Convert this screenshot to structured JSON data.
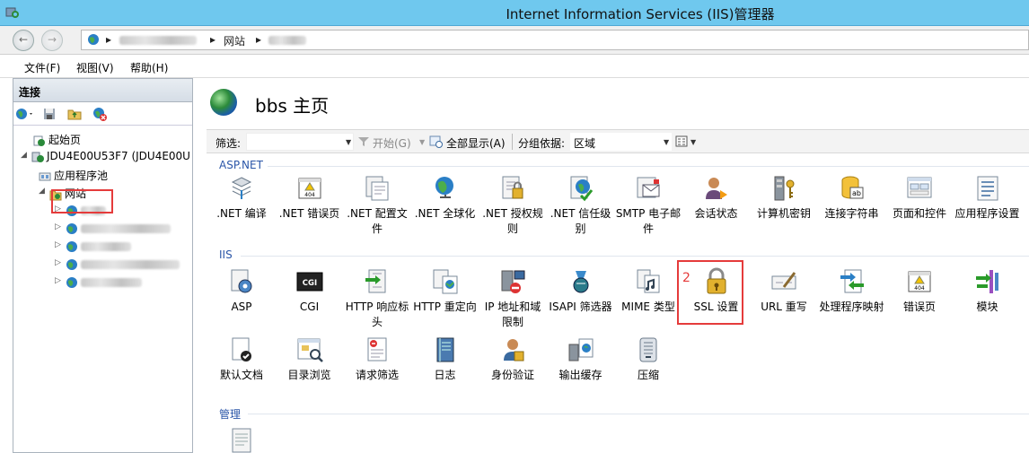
{
  "window": {
    "title": "Internet Information Services (IIS)管理器"
  },
  "address": {
    "crumbs": [
      "网站"
    ]
  },
  "menu": [
    "文件(F)",
    "视图(V)",
    "帮助(H)"
  ],
  "connections": {
    "header": "连接",
    "tree": [
      {
        "label": "起始页"
      },
      {
        "label": "JDU4E00U53F7 (JDU4E00U"
      },
      {
        "label": "应用程序池"
      },
      {
        "label": "网站"
      }
    ]
  },
  "page": {
    "title": "bbs 主页",
    "filter_label": "筛选:",
    "go_label": "开始(G)",
    "showall_label": "全部显示(A)",
    "groupby_label": "分组依据:",
    "groupby_value": "区域"
  },
  "sections": {
    "aspnet": "ASP.NET",
    "iis": "IIS",
    "manage": "管理"
  },
  "aspnet_features": [
    ".NET 编译",
    ".NET 错误页",
    ".NET 配置文件",
    ".NET 全球化",
    ".NET 授权规则",
    ".NET 信任级别",
    "SMTP 电子邮件",
    "会话状态",
    "计算机密钥",
    "连接字符串",
    "页面和控件",
    "应用程序设置"
  ],
  "iis_features_row1": [
    "ASP",
    "CGI",
    "HTTP 响应标头",
    "HTTP 重定向",
    "IP 地址和域限制",
    "ISAPI 筛选器",
    "MIME 类型",
    "SSL 设置",
    "URL 重写",
    "处理程序映射",
    "错误页",
    "模块"
  ],
  "iis_features_row2": [
    "默认文档",
    "目录浏览",
    "请求筛选",
    "日志",
    "身份验证",
    "输出缓存",
    "压缩"
  ],
  "annotation": {
    "step": "2"
  },
  "icons": {
    "cgi_text": "CGI",
    "err_text": "404"
  }
}
